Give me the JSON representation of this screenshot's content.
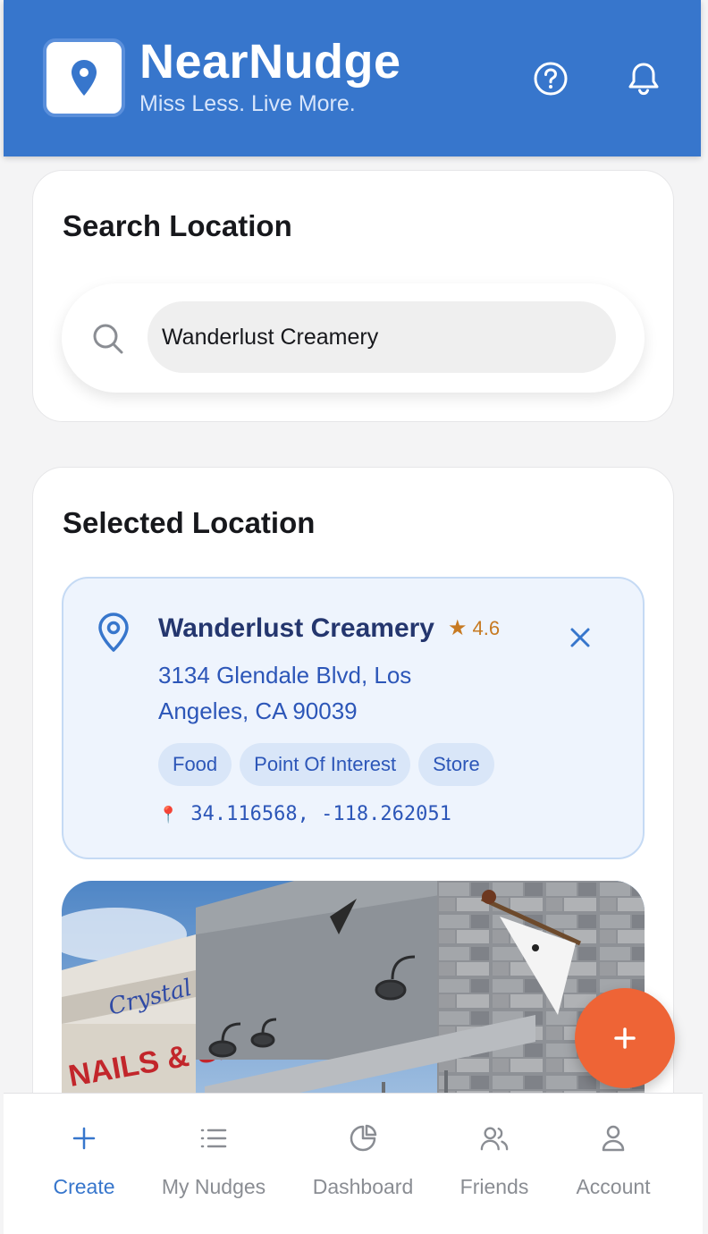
{
  "app": {
    "name": "NearNudge",
    "tagline": "Miss Less. Live More."
  },
  "search": {
    "title": "Search Location",
    "value": "Wanderlust Creamery"
  },
  "selected": {
    "title": "Selected Location",
    "name": "Wanderlust Creamery",
    "rating": "4.6",
    "address": "3134 Glendale Blvd, Los Angeles, CA 90039",
    "tags": [
      "Food",
      "Point Of Interest",
      "Store"
    ],
    "coordinates": "34.116568, -118.262051",
    "photo_sign_text": "NAILS & SP",
    "photo_script_text": "Crystal"
  },
  "nav": {
    "items": [
      {
        "label": "Create",
        "icon": "plus-icon",
        "active": true
      },
      {
        "label": "My Nudges",
        "icon": "list-icon",
        "active": false
      },
      {
        "label": "Dashboard",
        "icon": "pie-chart-icon",
        "active": false
      },
      {
        "label": "Friends",
        "icon": "people-icon",
        "active": false
      },
      {
        "label": "Account",
        "icon": "person-icon",
        "active": false
      }
    ]
  },
  "colors": {
    "header": "#3776cc",
    "accent": "#3776cc",
    "fab": "#ee6436",
    "panel": "#eef4fd",
    "rating": "#c77a22"
  }
}
